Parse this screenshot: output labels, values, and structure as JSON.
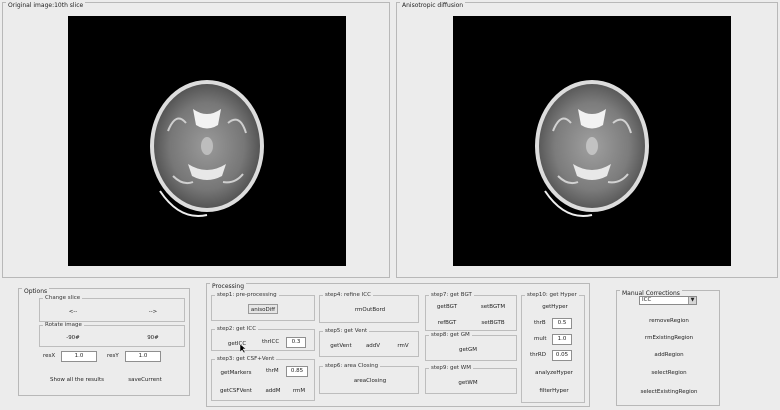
{
  "left_panel": {
    "title": "Original image:10th slice"
  },
  "right_panel": {
    "title": "Anisotropic diffusion"
  },
  "options": {
    "title": "Options",
    "change_slice": {
      "title": "Change slice",
      "prev": "<--",
      "next": "-->"
    },
    "rotate_image": {
      "title": "Rotate image",
      "minus90": "-90#",
      "plus90": "90#"
    },
    "resX_label": "resX",
    "resX_value": "1.0",
    "resY_label": "resY",
    "resY_value": "1.0",
    "show_all": "Show all the results",
    "save_current": "saveCurrent"
  },
  "processing": {
    "title": "Processing",
    "step1": {
      "title": "step1: pre-processing",
      "button": "anisoDiff"
    },
    "step2": {
      "title": "step2: get ICC",
      "button": "getICC",
      "thr_label": "thrICC",
      "thr_value": "0.3"
    },
    "step3": {
      "title": "step3: get CSF+Vent",
      "getMarkers": "getMarkers",
      "thr_label": "thrM",
      "thr_value": "0.85",
      "getCSFVent": "getCSFVent",
      "addM": "addM",
      "rmM": "rmM"
    },
    "step4": {
      "title": "step4: refine ICC",
      "button": "rmOutBord"
    },
    "step5": {
      "title": "step5: get Vent",
      "getVent": "getVent",
      "addV": "addV",
      "rmV": "rmV"
    },
    "step6": {
      "title": "step6: area Closing",
      "button": "areaClosing"
    },
    "step7": {
      "title": "step7: get BGT",
      "getBGT": "getBGT",
      "setBGTM": "setBGTM",
      "refBGT": "refBGT",
      "setBGTB": "setBGTB"
    },
    "step8": {
      "title": "step8: get GM",
      "button": "getGM"
    },
    "step9": {
      "title": "step9: get WM",
      "button": "getWM"
    },
    "step10": {
      "title": "step10: get Hyper",
      "getHyper": "getHyper",
      "thrB_label": "thrB",
      "thrB_value": "0.5",
      "mult_label": "mult",
      "mult_value": "1.0",
      "thrRD_label": "thrRD",
      "thrRD_value": "0.05",
      "analyzeHyper": "analyzeHyper",
      "filterHyper": "filterHyper"
    }
  },
  "manual": {
    "title": "Manual Corrections",
    "select_value": "ICC",
    "removeRegion": "removeRegion",
    "rmExistingRegion": "rmExistingRegion",
    "addRegion": "addRegion",
    "selectRegion": "selectRegion",
    "selectExistingRegion": "selectExistingRegion"
  },
  "icons": {
    "dropdown": "chevron-down-icon",
    "cursor": "mouse-pointer-icon"
  }
}
